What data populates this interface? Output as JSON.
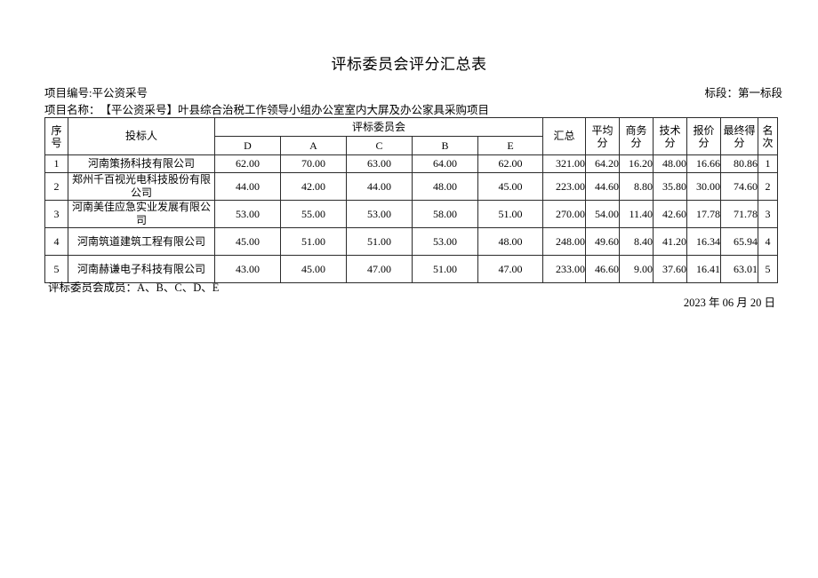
{
  "document": {
    "title": "评标委员会评分汇总表",
    "project_number_label": "项目编号:",
    "project_number": "平公资采号",
    "project_name_label": "项目名称：",
    "project_name": "【平公资采号】叶县综合治税工作领导小组办公室室内大屏及办公家具采购项目",
    "section_label": "标段：",
    "section_value": "第一标段",
    "members_note": "评标委员会成员：A、B、C、D、E",
    "date": "2023 年 06 月 20 日"
  },
  "table": {
    "headers": {
      "index_char1": "序",
      "index_char2": "号",
      "bidder": "投标人",
      "committee_group": "评标委员会",
      "judges": [
        "D",
        "A",
        "C",
        "B",
        "E"
      ],
      "total": "汇总",
      "average_line1": "平均",
      "average_line2": "分",
      "business_line1": "商务",
      "business_line2": "分",
      "technical_line1": "技术",
      "technical_line2": "分",
      "price_line1": "报价",
      "price_line2": "分",
      "final_line1": "最终得",
      "final_line2": "分",
      "rank_char1": "名",
      "rank_char2": "次"
    },
    "rows": [
      {
        "index": "1",
        "bidder": "河南策扬科技有限公司",
        "scores": [
          "62.00",
          "70.00",
          "63.00",
          "64.00",
          "62.00"
        ],
        "total": "321.00",
        "average": "64.20",
        "business": "16.20",
        "technical": "48.00",
        "price": "16.66",
        "final": "80.86",
        "rank": "1"
      },
      {
        "index": "2",
        "bidder": "郑州千百视光电科技股份有限公司",
        "scores": [
          "44.00",
          "42.00",
          "44.00",
          "48.00",
          "45.00"
        ],
        "total": "223.00",
        "average": "44.60",
        "business": "8.80",
        "technical": "35.80",
        "price": "30.00",
        "final": "74.60",
        "rank": "2"
      },
      {
        "index": "3",
        "bidder": "河南美佳应急实业发展有限公司",
        "scores": [
          "53.00",
          "55.00",
          "53.00",
          "58.00",
          "51.00"
        ],
        "total": "270.00",
        "average": "54.00",
        "business": "11.40",
        "technical": "42.60",
        "price": "17.78",
        "final": "71.78",
        "rank": "3"
      },
      {
        "index": "4",
        "bidder": "河南筑道建筑工程有限公司",
        "scores": [
          "45.00",
          "51.00",
          "51.00",
          "53.00",
          "48.00"
        ],
        "total": "248.00",
        "average": "49.60",
        "business": "8.40",
        "technical": "41.20",
        "price": "16.34",
        "final": "65.94",
        "rank": "4"
      },
      {
        "index": "5",
        "bidder": "河南赫谦电子科技有限公司",
        "scores": [
          "43.00",
          "45.00",
          "47.00",
          "51.00",
          "47.00"
        ],
        "total": "233.00",
        "average": "46.60",
        "business": "9.00",
        "technical": "37.60",
        "price": "16.41",
        "final": "63.01",
        "rank": "5"
      }
    ]
  }
}
